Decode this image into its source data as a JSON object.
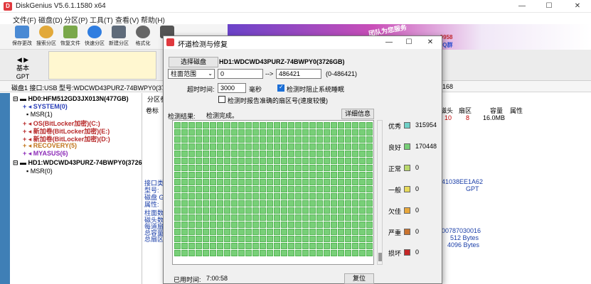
{
  "window": {
    "title": "DiskGenius V5.6.1.1580 x64",
    "app_icon": "diskgenius-logo",
    "minimize": "—",
    "maximize": "☐",
    "close": "✕"
  },
  "menu": [
    "文件(F)",
    "磁盘(D)",
    "分区(P)",
    "工具(T)",
    "查看(V)",
    "帮助(H)"
  ],
  "toolbar": [
    {
      "label": "保存更改",
      "icon": "save-icon",
      "color": "#4a8ad4"
    },
    {
      "label": "搜索分区",
      "icon": "search-icon",
      "color": "#e2a93a"
    },
    {
      "label": "恢复文件",
      "icon": "recover-icon",
      "color": "#7aa84a"
    },
    {
      "label": "快速分区",
      "icon": "quick-partition-icon",
      "color": "#2f7de0"
    },
    {
      "label": "新建分区",
      "icon": "new-partition-icon",
      "color": "#5f6b7a"
    },
    {
      "label": "格式化",
      "icon": "format-icon",
      "color": "#666666"
    },
    {
      "label": "删",
      "icon": "delete-icon",
      "color": "#555555"
    }
  ],
  "banner": {
    "text1": "团队为您服务",
    "text2": "-9958",
    "text3": "QQ群"
  },
  "disk_map": {
    "type": "基本",
    "scheme": "GPT"
  },
  "info_bar": {
    "left": "磁盘1 接口:USB  型号:WDCWD43PURZ-74BWPY0(3726GB)  序列号",
    "right": "168"
  },
  "tree": [
    {
      "text": "HD0:HFM512GD3JX013N(477GB)",
      "level": 0,
      "kind": "disk",
      "color": "#000000"
    },
    {
      "text": "SYSTEM(0)",
      "level": 1,
      "kind": "part",
      "color": "#2a3fb8"
    },
    {
      "text": "MSR(1)",
      "level": 1,
      "kind": "part-plain",
      "color": "#000000"
    },
    {
      "text": "OS(BitLocker加密)(C:)",
      "level": 1,
      "kind": "part",
      "color": "#b82a2a"
    },
    {
      "text": "新加卷(BitLocker加密)(E:)",
      "level": 1,
      "kind": "part",
      "color": "#b82a2a"
    },
    {
      "text": "新加卷(BitLocker加密)(D:)",
      "level": 1,
      "kind": "part",
      "color": "#b82a2a"
    },
    {
      "text": "RECOVERY(5)",
      "level": 1,
      "kind": "part",
      "color": "#c0741a"
    },
    {
      "text": "MYASUS(6)",
      "level": 1,
      "kind": "part",
      "color": "#8c2ab8"
    },
    {
      "text": "HD1:WDCWD43PURZ-74BWPY0(3726",
      "level": 0,
      "kind": "disk",
      "color": "#000000"
    },
    {
      "text": "MSR(0)",
      "level": 1,
      "kind": "part-plain",
      "color": "#000000"
    }
  ],
  "right_pane": {
    "tab": "分区参",
    "col_label": "卷标",
    "headers": [
      "磁头",
      "扇区",
      "容量",
      "属性"
    ],
    "row": [
      "10",
      "8",
      "16.0MB",
      ""
    ],
    "info_labels": [
      "接口类",
      "型号:",
      "磁盘 G",
      "属性:",
      "柱面数",
      "磁头数",
      "每道扇",
      "总容量",
      "总扇区"
    ],
    "info_values": [
      "41038EE1A62",
      "GPT",
      "00787030016",
      "512 Bytes",
      "4096 Bytes"
    ]
  },
  "dialog": {
    "title": "坏道检测与修复",
    "select_disk_btn": "选择磁盘",
    "disk_name": "HD1:WDCWD43PURZ-74BWPY0(3726GB)",
    "range_select": "柱面范围",
    "range_start": "0",
    "range_arrow": "-->",
    "range_end": "486421",
    "range_hint": "(0-486421)",
    "timeout_label": "超时时间:",
    "timeout_value": "3000",
    "timeout_unit": "毫秒",
    "opt1": "检测时阻止系统睡眠",
    "opt1_checked": true,
    "opt2": "检测时报告准确的扇区号(速度较慢)",
    "opt2_checked": false,
    "result_label": "检测结果:",
    "result_status": "检测完成。",
    "details_btn": "详细信息",
    "elapsed_label": "已用时间:",
    "elapsed_value": "7:00:58",
    "reset_btn": "复位",
    "legend": [
      {
        "label": "优秀",
        "color": "#6fd0c7",
        "value": "315954"
      },
      {
        "label": "良好",
        "color": "#78cf78",
        "value": "170448"
      },
      {
        "label": "正常",
        "color": "#b9d86c",
        "value": "0"
      },
      {
        "label": "一般",
        "color": "#e6d95a",
        "value": "0"
      },
      {
        "label": "欠佳",
        "color": "#e8a73b",
        "value": "0"
      },
      {
        "label": "严重",
        "color": "#c9732f",
        "value": "0"
      },
      {
        "label": "损坏",
        "color": "#c62828",
        "value": "0"
      }
    ]
  }
}
